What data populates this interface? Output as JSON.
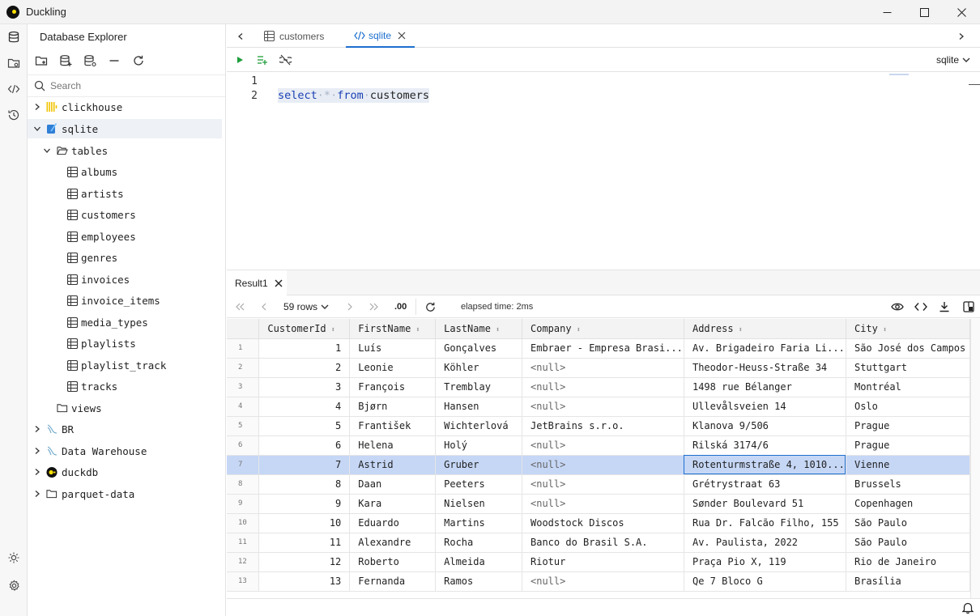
{
  "window": {
    "title": "Duckling"
  },
  "explorer": {
    "title": "Database Explorer",
    "search_placeholder": "Search",
    "tree": {
      "clickhouse": "clickhouse",
      "sqlite": "sqlite",
      "tables": "tables",
      "tables_list": [
        "albums",
        "artists",
        "customers",
        "employees",
        "genres",
        "invoices",
        "invoice_items",
        "media_types",
        "playlists",
        "playlist_track",
        "tracks"
      ],
      "views": "views",
      "br": "BR",
      "data_warehouse": "Data Warehouse",
      "duckdb": "duckdb",
      "parquet": "parquet-data"
    }
  },
  "tabs": {
    "customers": "customers",
    "sqlite": "sqlite"
  },
  "editor": {
    "connection": "sqlite",
    "line1": "1",
    "line2": "2",
    "kw_select": "select",
    "star": "*",
    "kw_from": "from",
    "table": "customers",
    "dot": "·"
  },
  "results": {
    "tab_label": "Result1",
    "rows_label": "59 rows",
    "decimals": ".00",
    "elapsed": "elapsed time: 2ms",
    "columns": [
      "CustomerId",
      "FirstName",
      "LastName",
      "Company",
      "Address",
      "City"
    ],
    "rows": [
      [
        "1",
        "1",
        "Luís",
        "Gonçalves",
        "Embraer - Empresa Brasi...",
        "Av. Brigadeiro Faria Li...",
        "São José dos Campos"
      ],
      [
        "2",
        "2",
        "Leonie",
        "Köhler",
        "<null>",
        "Theodor-Heuss-Straße 34",
        "Stuttgart"
      ],
      [
        "3",
        "3",
        "François",
        "Tremblay",
        "<null>",
        "1498 rue Bélanger",
        "Montréal"
      ],
      [
        "4",
        "4",
        "Bjørn",
        "Hansen",
        "<null>",
        "Ullevålsveien 14",
        "Oslo"
      ],
      [
        "5",
        "5",
        "František",
        "Wichterlová",
        "JetBrains s.r.o.",
        "Klanova 9/506",
        "Prague"
      ],
      [
        "6",
        "6",
        "Helena",
        "Holý",
        "<null>",
        "Rilská 3174/6",
        "Prague"
      ],
      [
        "7",
        "7",
        "Astrid",
        "Gruber",
        "<null>",
        "Rotenturmstraße 4, 1010...",
        "Vienne"
      ],
      [
        "8",
        "8",
        "Daan",
        "Peeters",
        "<null>",
        "Grétrystraat 63",
        "Brussels"
      ],
      [
        "9",
        "9",
        "Kara",
        "Nielsen",
        "<null>",
        "Sønder Boulevard 51",
        "Copenhagen"
      ],
      [
        "10",
        "10",
        "Eduardo",
        "Martins",
        "Woodstock Discos",
        "Rua Dr. Falcão Filho, 155",
        "São Paulo"
      ],
      [
        "11",
        "11",
        "Alexandre",
        "Rocha",
        "Banco do Brasil S.A.",
        "Av. Paulista, 2022",
        "São Paulo"
      ],
      [
        "12",
        "12",
        "Roberto",
        "Almeida",
        "Riotur",
        "Praça Pio X, 119",
        "Rio de Janeiro"
      ],
      [
        "13",
        "13",
        "Fernanda",
        "Ramos",
        "<null>",
        "Qe 7 Bloco G",
        "Brasília"
      ]
    ],
    "selected_row": 7
  },
  "colors": {
    "accent": "#1d6fcf",
    "selection": "#c6d7f6",
    "keyword": "#1a3fb3"
  },
  "icons": [
    "database-icon",
    "folder-link-icon",
    "code-icon",
    "history-icon",
    "sun-icon",
    "settings-icon",
    "bell-icon",
    "run-icon",
    "run-selection-icon",
    "disconnect-icon",
    "eye-icon",
    "download-icon"
  ]
}
